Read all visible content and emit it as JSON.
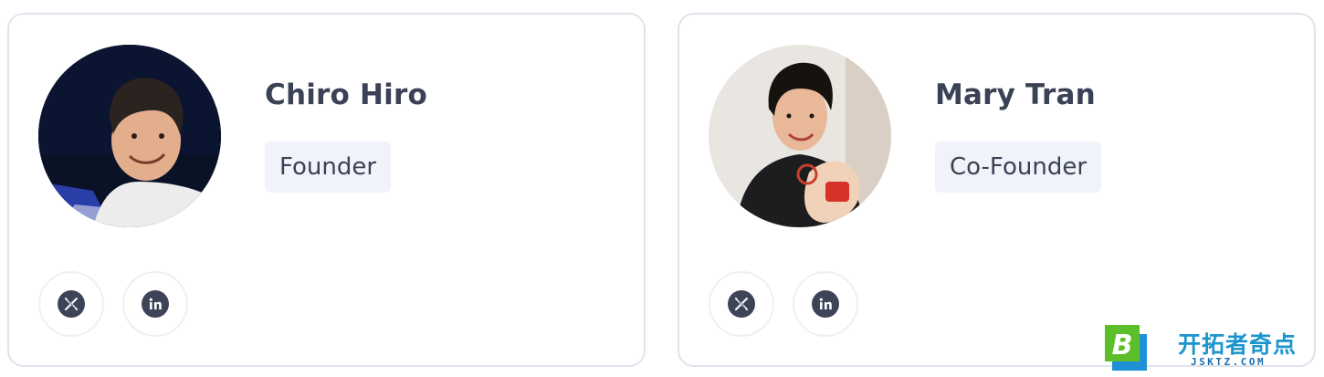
{
  "team": [
    {
      "name": "Chiro Hiro",
      "role": "Founder",
      "socials": [
        {
          "icon": "x-icon"
        },
        {
          "icon": "linkedin-icon"
        }
      ]
    },
    {
      "name": "Mary Tran",
      "role": "Co-Founder",
      "socials": [
        {
          "icon": "x-icon"
        },
        {
          "icon": "linkedin-icon"
        }
      ]
    }
  ],
  "watermark": {
    "title": "开拓者奇点",
    "domain": "JSKTZ.COM"
  },
  "colors": {
    "text": "#3b4256",
    "role_badge_bg": "#f0f3f9",
    "card_border": "#dfe4ec",
    "icon_fill": "#3d4458"
  }
}
